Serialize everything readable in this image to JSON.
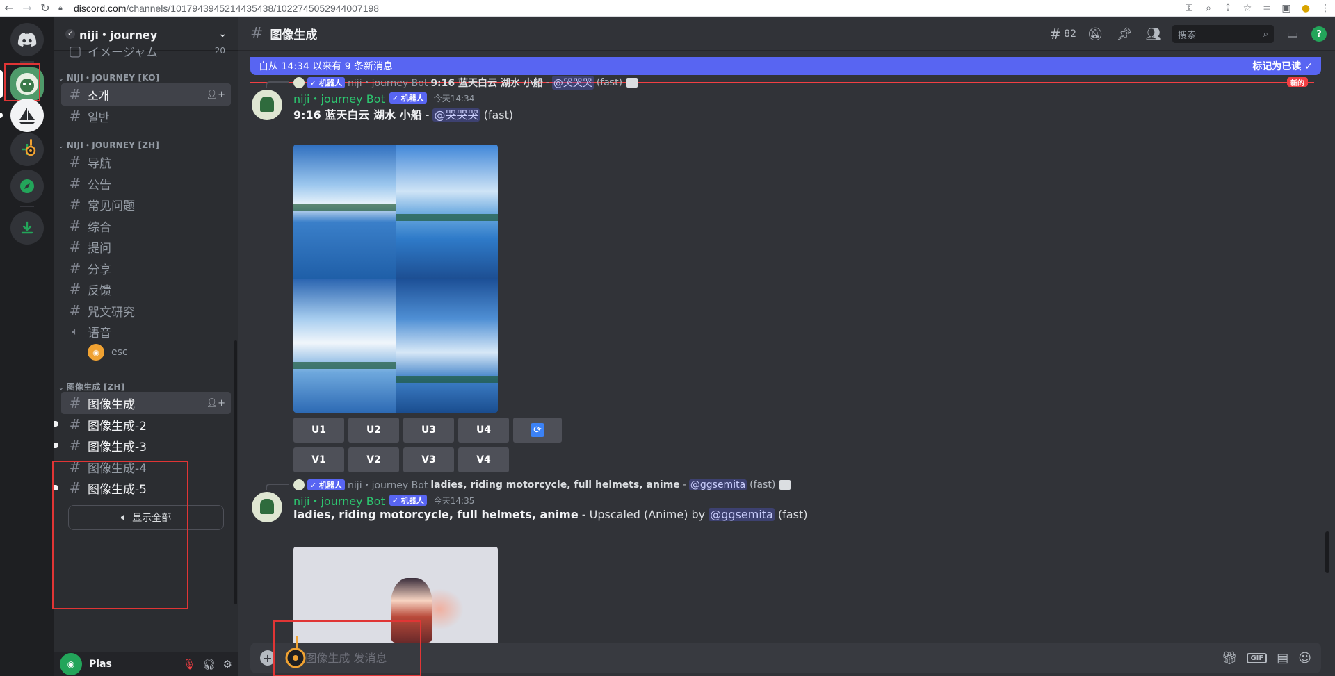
{
  "browser": {
    "url_domain": "discord.com",
    "url_path": "/channels/1017943945214435438/1022745052944007198"
  },
  "guild": {
    "name": "niji・journey",
    "partial_channel": "イメージャム",
    "partial_count": "20"
  },
  "categories": {
    "ko": "NIJI・JOURNEY [KO]",
    "zh": "NIJI・JOURNEY [ZH]",
    "image": "图像生成 [ZH]"
  },
  "channels_ko": [
    "소개",
    "일반"
  ],
  "channels_zh": [
    "导航",
    "公告",
    "常见问题",
    "综合",
    "提问",
    "分享",
    "反馈",
    "咒文研究"
  ],
  "voice": {
    "channel": "语音",
    "user": "esc"
  },
  "image_channels": [
    "图像生成",
    "图像生成-2",
    "图像生成-3",
    "图像生成-4",
    "图像生成-5"
  ],
  "show_all": "显示全部",
  "user": {
    "name": "Plas"
  },
  "topbar": {
    "channel": "图像生成",
    "thread_count": "82",
    "search_placeholder": "搜索"
  },
  "banner": {
    "text": "自从 14:34 以来有 9 条新消息",
    "mark_read": "标记为已读",
    "new_tag": "新的"
  },
  "messages": [
    {
      "reply_bot_tag": "✓ 机器人",
      "reply_name": "niji・journey Bot",
      "reply_prompt": "9:16 蓝天白云 湖水 小船",
      "reply_mention": "@哭哭哭",
      "reply_suffix": "(fast)",
      "author": "niji・journey Bot",
      "bot_tag": "✓ 机器人",
      "time": "今天14:34",
      "prompt": "9:16 蓝天白云 湖水 小船",
      "separator": " - ",
      "mention": "@哭哭哭",
      "suffix": " (fast)",
      "buttons_u": [
        "U1",
        "U2",
        "U3",
        "U4"
      ],
      "buttons_v": [
        "V1",
        "V2",
        "V3",
        "V4"
      ]
    },
    {
      "reply_bot_tag": "✓ 机器人",
      "reply_name": "niji・journey Bot",
      "reply_prompt": "ladies, riding motorcycle, full helmets, anime",
      "reply_mention": "@ggsemita",
      "reply_suffix": "(fast)",
      "author": "niji・journey Bot",
      "bot_tag": "✓ 机器人",
      "time": "今天14:35",
      "prompt": "ladies, riding motorcycle, full helmets, anime",
      "middle": " - Upscaled (Anime) by ",
      "mention": "@ggsemita",
      "suffix": " (fast)"
    }
  ],
  "composer": {
    "placeholder": "给#图像生成 发消息"
  },
  "colors": {
    "accent": "#5865f2",
    "bot_green": "#2dc770",
    "highlight_red": "#e03535",
    "unread_line": "#f23f43"
  }
}
